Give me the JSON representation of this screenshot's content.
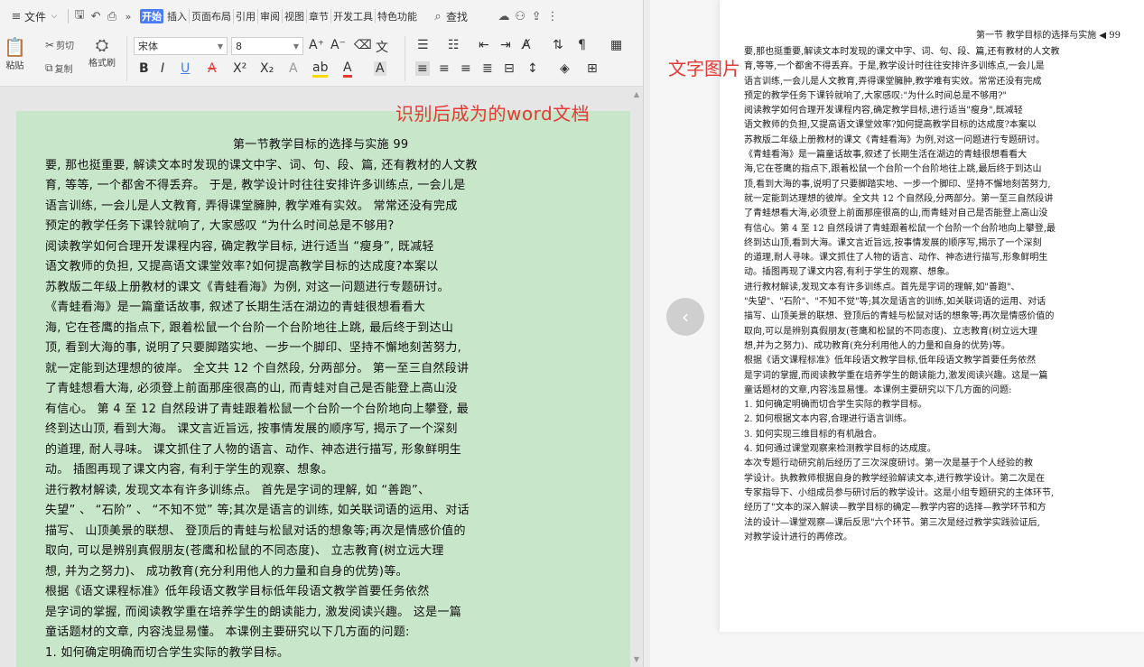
{
  "menubar": {
    "file_label": "文件",
    "tabs": [
      "开始",
      "插入",
      "页面布局",
      "引用",
      "审阅",
      "视图",
      "章节",
      "开发工具",
      "特色功能"
    ],
    "search_label": "查找"
  },
  "ribbon": {
    "paste_label": "粘贴",
    "cut_label": "剪切",
    "copy_label": "复制",
    "format_painter_label": "格式刷",
    "font_name": "宋体",
    "font_size": "8",
    "bold": "B",
    "italic": "I",
    "underline": "U",
    "strike": "A",
    "superscript": "X²",
    "subscript": "X₂",
    "increase_font": "A⁺",
    "decrease_font": "A⁻",
    "highlight": "ab",
    "font_color": "A",
    "char_shading": "A"
  },
  "annotations": {
    "left": "识别后成为的word文档",
    "right": "文字图片"
  },
  "document": {
    "heading": "第一节教学目标的选择与实施 99",
    "lines": [
      "要, 那也挺重要, 解读文本时发现的课文中字、词、句、段、篇, 还有教材的人文教",
      "育, 等等, 一个都舍不得丢弃。 于是, 教学设计时往往安排许多训练点, 一会儿是",
      "语言训练, 一会儿是人文教育, 弄得课堂臃肿, 教学难有实效。 常常还没有完成",
      "预定的教学任务下课铃就响了, 大家感叹 “为什么时间总是不够用?",
      "    阅读教学如何合理开发课程内容, 确定教学目标, 进行适当 “瘦身”, 既减轻",
      "语文教师的负担, 又提高语文课堂效率?如何提高教学目标的达成度?本案以",
      "苏教版二年级上册教材的课文《青蛙看海》为例, 对这一问题进行专题研讨。",
      "    《青蛙看海》是一篇童话故事, 叙述了长期生活在湖边的青蛙很想看看大",
      "海, 它在苍鹰的指点下, 跟着松鼠一个台阶一个台阶地往上跳, 最后终于到达山",
      "顶, 看到大海的事, 说明了只要脚踏实地、一步一个脚印、坚持不懈地刻苦努力,",
      "就一定能到达理想的彼岸。 全文共 12 个自然段, 分两部分。 第一至三自然段讲",
      "了青蛙想看大海, 必须登上前面那座很高的山, 而青蛙对自己是否能登上高山没",
      "有信心。 第 4 至 12 自然段讲了青蛙跟着松鼠一个台阶一个台阶地向上攀登, 最",
      "终到达山顶, 看到大海。 课文言近旨远, 按事情发展的顺序写, 揭示了一个深刻",
      "的道理, 耐人寻味。 课文抓住了人物的语言、动作、神态进行描写, 形象鲜明生",
      "动。 插图再现了课文内容, 有利于学生的观察、想象。",
      "    进行教材解读, 发现文本有许多训练点。 首先是字词的理解, 如 “善跑”、",
      "失望” 、 “石阶” 、 “不知不觉” 等;其次是语言的训练, 如关联词语的运用、对话",
      "描写、 山顶美景的联想、 登顶后的青蛙与松鼠对话的想象等;再次是情感价值的",
      "取向, 可以是辨别真假朋友(苍鹰和松鼠的不同态度)、 立志教育(树立远大理",
      "想, 并为之努力)、 成功教育(充分利用他人的力量和自身的优势)等。",
      "    根据《语文课程标准》低年段语文教学目标低年段语文教学首要任务依然",
      "是字词的掌握, 而阅读教学重在培养学生的朗读能力, 激发阅读兴趣。 这是一篇",
      "童话题材的文章, 内容浅显易懂。 本课例主要研究以下几方面的问题:",
      "    1. 如何确定明确而切合学生实际的教学目标。"
    ]
  },
  "scan": {
    "header": "第一节  教学目标的选择与实施  ◀ 99",
    "lines": [
      "要,那也挺重要,解读文本时发现的课文中字、词、句、段、篇,还有教材的人文教",
      "育,等等,一个都舍不得丢弃。于是,教学设计时往往安排许多训练点,一会儿是",
      "语言训练,一会儿是人文教育,弄得课堂臃肿,教学难有实效。常常还没有完成",
      "预定的教学任务下课铃就响了,大家感叹:\"为什么时间总是不够用?\"",
      "    阅读教学如何合理开发课程内容,确定教学目标,进行适当\"瘦身\",既减轻",
      "语文教师的负担,又提高语文课堂效率?如何提高教学目标的达成度?本案以",
      "苏教版二年级上册教材的课文《青蛙看海》为例,对这一问题进行专题研讨。",
      "    《青蛙看海》是一篇童话故事,叙述了长期生活在湖边的青蛙很想看看大",
      "海,它在苍鹰的指点下,跟着松鼠一个台阶一个台阶地往上跳,最后终于到达山",
      "顶,看到大海的事,说明了只要脚踏实地、一步一个脚印、坚持不懈地刻苦努力,",
      "就一定能到达理想的彼岸。全文共 12 个自然段,分两部分。第一至三自然段讲",
      "了青蛙想看大海,必须登上前面那座很高的山,而青蛙对自己是否能登上高山没",
      "有信心。第 4 至 12 自然段讲了青蛙跟着松鼠一个台阶一个台阶地向上攀登,最",
      "终到达山顶,看到大海。课文言近旨远,按事情发展的顺序写,揭示了一个深刻",
      "的道理,耐人寻味。课文抓住了人物的语言、动作、神态进行描写,形象鲜明生",
      "动。插图再现了课文内容,有利于学生的观察、想象。",
      "    进行教材解读,发现文本有许多训练点。首先是字词的理解,如\"善跑\"、",
      "\"失望\"、\"石阶\"、\"不知不觉\"等;其次是语言的训练,如关联词语的运用、对话",
      "描写、山顶美景的联想、登顶后的青蛙与松鼠对话的想象等;再次是情感价值的",
      "取向,可以是辨别真假朋友(苍鹰和松鼠的不同态度)、立志教育(树立远大理",
      "想,并为之努力)、成功教育(充分利用他人的力量和自身的优势)等。",
      "    根据《语文课程标准》低年段语文教学目标,低年段语文教学首要任务依然",
      "是字词的掌握,而阅读教学重在培养学生的朗读能力,激发阅读兴趣。这是一篇",
      "童话题材的文章,内容浅显易懂。本课例主要研究以下几方面的问题:",
      "    1. 如何确定明确而切合学生实际的教学目标。",
      "    2. 如何根据文本内容,合理进行语言训练。",
      "    3. 如何实现三维目标的有机融合。",
      "    4. 如何通过课堂观察来检测教学目标的达成度。",
      "    本次专题行动研究前后经历了三次深度研讨。第一次是基于个人经验的教",
      "学设计。执教教师根据自身的教学经验解读文本,进行教学设计。第二次是在",
      "专家指导下、小组成员参与研讨后的教学设计。这是小组专题研究的主体环节,",
      "经历了\"文本的深入解读—教学目标的确定—教学内容的选择—教学环节和方",
      "法的设计—课堂观察—课后反思\"六个环节。第三次是经过教学实践验证后,",
      "对教学设计进行的再修改。"
    ]
  },
  "colors": {
    "accent": "#4a7cf6",
    "page_bg": "#c8e6c9",
    "annotation": "#e53935"
  }
}
